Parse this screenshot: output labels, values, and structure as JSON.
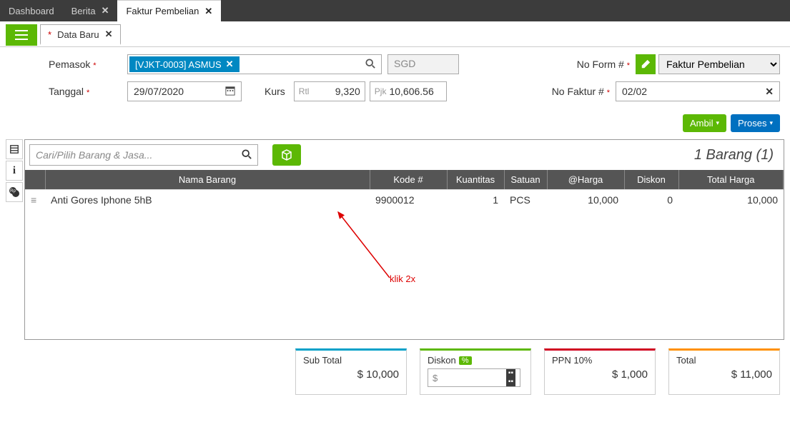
{
  "tabs": [
    {
      "label": "Dashboard",
      "closable": false
    },
    {
      "label": "Berita",
      "closable": true
    },
    {
      "label": "Faktur Pembelian",
      "closable": true,
      "active": true
    }
  ],
  "dataTab": {
    "label": "Data Baru"
  },
  "form": {
    "supplier_label": "Pemasok",
    "supplier_value": "[VJKT-0003] ASMUS",
    "currency": "SGD",
    "date_label": "Tanggal",
    "date_value": "29/07/2020",
    "kurs_label": "Kurs",
    "kurs_rtl_prefix": "Rtl",
    "kurs_rtl_value": "9,320",
    "kurs_pjk_prefix": "Pjk",
    "kurs_pjk_value": "10,606.56",
    "no_form_label": "No Form #",
    "no_form_value": "Faktur Pembelian",
    "no_faktur_label": "No Faktur #",
    "no_faktur_value": "02/02"
  },
  "actions": {
    "ambil": "Ambil",
    "proses": "Proses"
  },
  "items": {
    "search_placeholder": "Cari/Pilih Barang & Jasa...",
    "count_label": "1 Barang (1)",
    "columns": {
      "nama": "Nama Barang",
      "kode": "Kode #",
      "kuantitas": "Kuantitas",
      "satuan": "Satuan",
      "harga": "@Harga",
      "diskon": "Diskon",
      "total": "Total Harga"
    },
    "rows": [
      {
        "nama": "Anti Gores Iphone 5hB",
        "kode": "9900012",
        "kuantitas": "1",
        "satuan": "PCS",
        "harga": "10,000",
        "diskon": "0",
        "total": "10,000"
      }
    ]
  },
  "annotation": {
    "text": "klik 2x"
  },
  "totals": {
    "subtotal_label": "Sub Total",
    "subtotal_value": "$ 10,000",
    "diskon_label": "Diskon",
    "diskon_badge": "%",
    "diskon_placeholder": "$",
    "ppn_label": "PPN 10%",
    "ppn_value": "$ 1,000",
    "total_label": "Total",
    "total_value": "$ 11,000"
  }
}
